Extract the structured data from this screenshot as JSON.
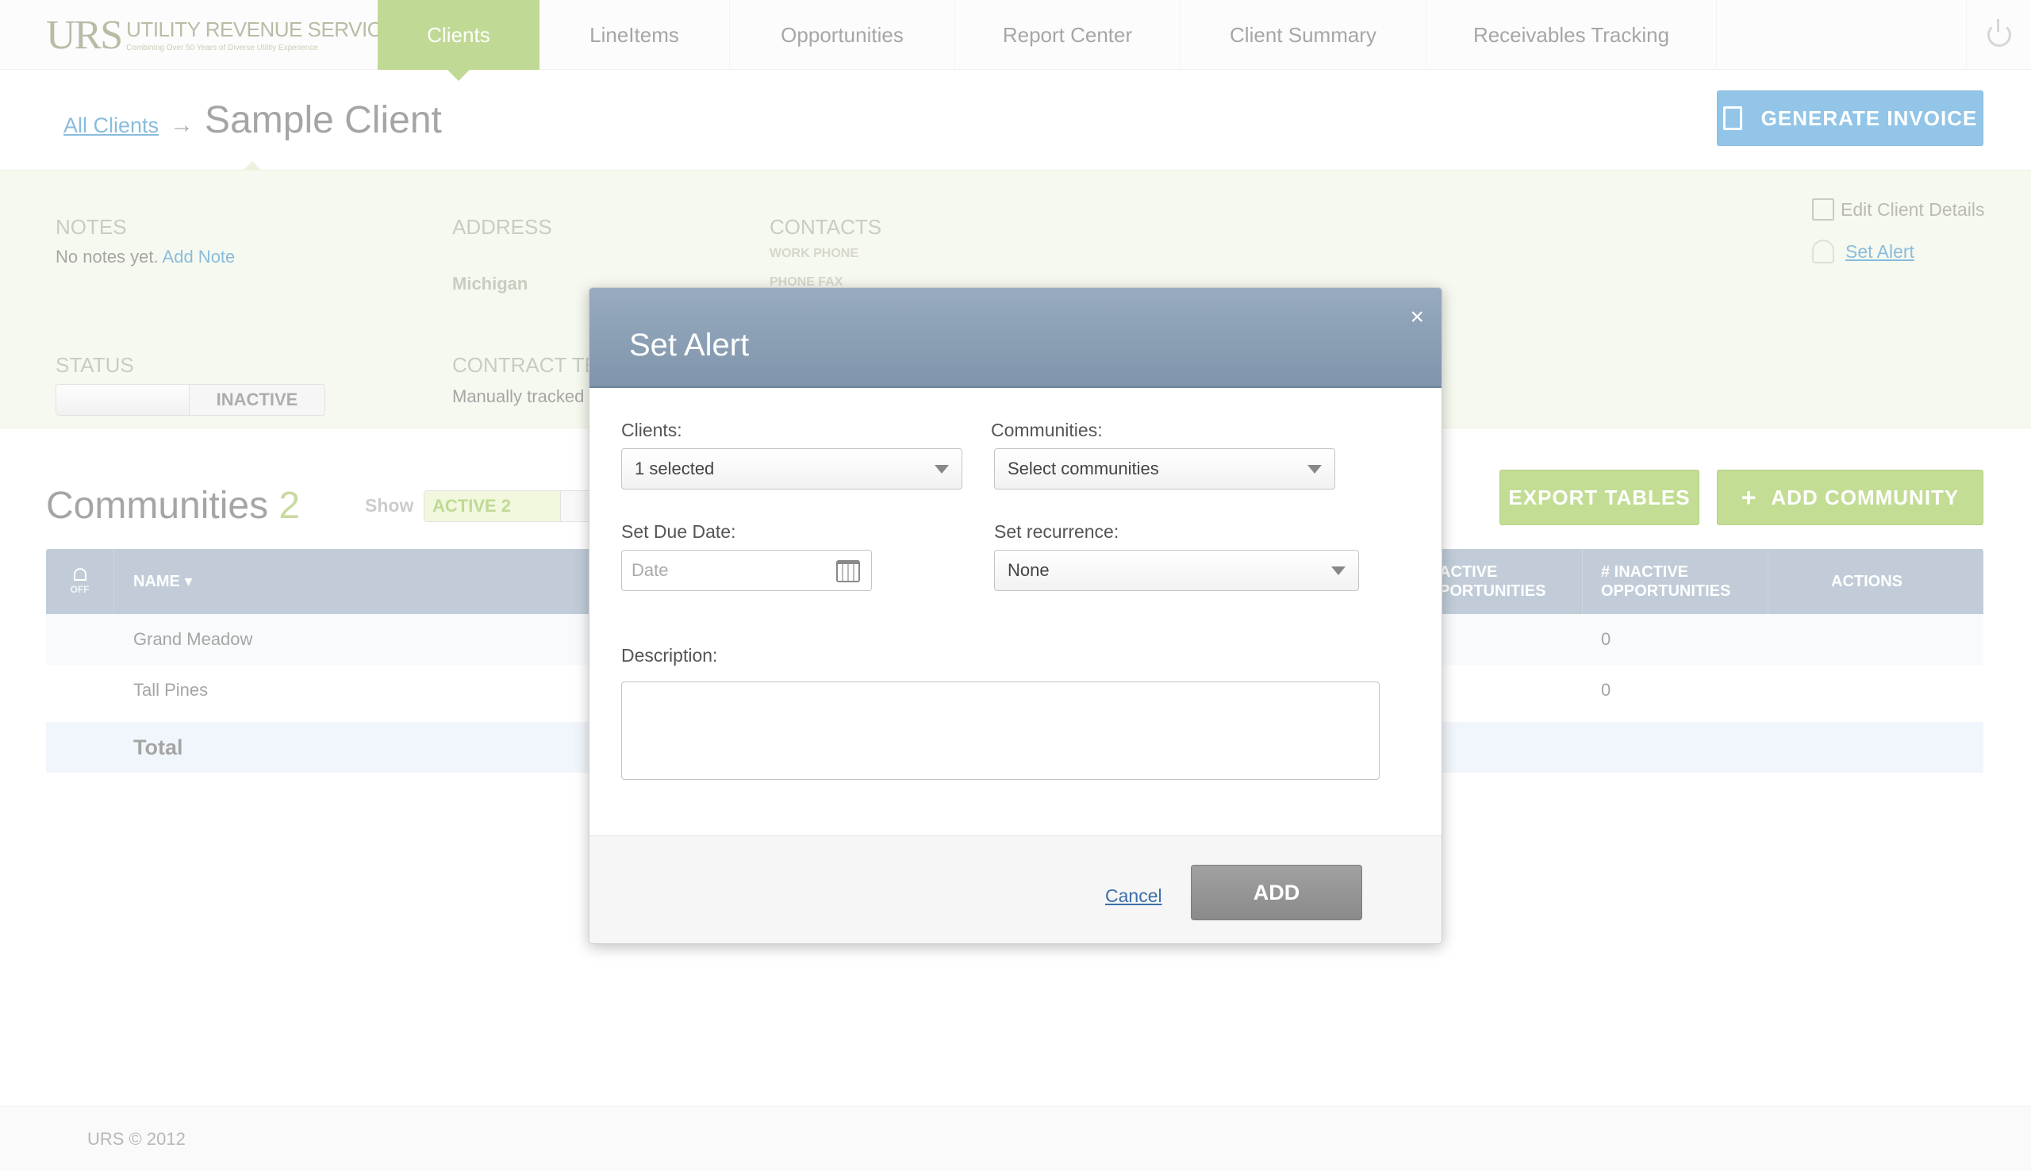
{
  "app": {
    "logo_mark": "URS",
    "logo_name": "UTILITY REVENUE SERVICES",
    "logo_tagline": "Combining Over 50 Years of Diverse Utility Experience"
  },
  "nav": {
    "tabs": [
      {
        "label": "Clients",
        "active": true
      },
      {
        "label": "LineItems",
        "active": false
      },
      {
        "label": "Opportunities",
        "active": false
      },
      {
        "label": "Report Center",
        "active": false
      },
      {
        "label": "Client Summary",
        "active": false
      },
      {
        "label": "Receivables Tracking",
        "active": false
      }
    ],
    "power_icon": "power-icon"
  },
  "header": {
    "breadcrumb_link": "All Clients",
    "breadcrumb_arrow": "→",
    "title": "Sample Client",
    "generate_invoice": "GENERATE INVOICE"
  },
  "info": {
    "notes_label": "NOTES",
    "notes_text": "No notes yet.",
    "add_note": "Add Note",
    "address_label": "ADDRESS",
    "address_value": "Michigan",
    "contacts_label": "CONTACTS",
    "work_phone": "WORK PHONE",
    "phone_fax": "PHONE FAX",
    "status_label": "STATUS",
    "status_value": "INACTIVE",
    "contract_label": "CONTRACT TE",
    "contract_value": "Manually tracked",
    "edit_client": "Edit Client Details",
    "set_alert": "Set Alert"
  },
  "communities": {
    "title": "Communities",
    "count": "2",
    "show_label": "Show",
    "show_toggle": "ACTIVE 2",
    "export_button": "EXPORT TABLES",
    "add_button": "ADD  COMMUNITY",
    "add_symbol": "+",
    "filter_label": "OFF",
    "columns": {
      "name": "NAME ▾",
      "active_opps": "ACTIVE\nPORTUNITIES",
      "inactive_opps": "# INACTIVE\nOPPORTUNITIES",
      "actions": "ACTIONS"
    },
    "rows": [
      {
        "name": "Grand Meadow",
        "inactive": "0"
      },
      {
        "name": "Tall Pines",
        "inactive": "0"
      }
    ],
    "total_label": "Total"
  },
  "footer": {
    "text": "URS © 2012"
  },
  "modal": {
    "title": "Set Alert",
    "close": "×",
    "clients_label": "Clients:",
    "clients_value": "1 selected",
    "communities_label": "Communities:",
    "communities_value": "Select communities",
    "due_date_label": "Set Due Date:",
    "due_date_placeholder": "Date",
    "recurrence_label": "Set recurrence:",
    "recurrence_value": "None",
    "description_label": "Description:",
    "description_value": "",
    "cancel": "Cancel",
    "add": "ADD"
  },
  "colors": {
    "accent_green": "#96c04d",
    "accent_blue": "#4a9fd8",
    "table_header": "#98abbe"
  }
}
